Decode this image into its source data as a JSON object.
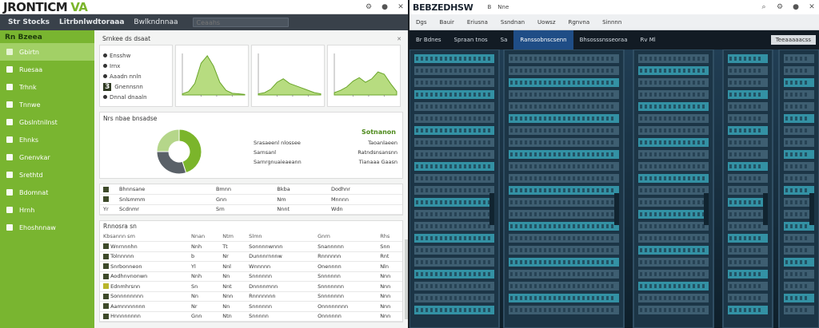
{
  "left_app": {
    "brand": "JRONTICM",
    "brand_suffix": "VA",
    "menu": [
      "Str Stocks",
      "Litrbnlwdtoraaa",
      "Bwlkndnnaa"
    ],
    "search_placeholder": "Ceaahs",
    "sidebar": {
      "header": "Rn Bzeea",
      "items": [
        "Gbirtn",
        "Ruesaa",
        "Trhnk",
        "Tnnwe",
        "Gbslntnilnst",
        "Ehnks",
        "Gnenvkar",
        "Srethtd",
        "Bdomnat",
        "Hrnh",
        "Ehoshnnaw"
      ]
    },
    "section_top": "Srnkee ds dsaat",
    "info_card": {
      "rows": [
        {
          "num": "",
          "label": "Ensshw"
        },
        {
          "num": "",
          "label": "Irnx"
        },
        {
          "num": "",
          "label": "Aaadn nnln"
        },
        {
          "num": "3",
          "label": "Gnennsnn"
        },
        {
          "num": "",
          "label": "Dnnal dnaaln"
        }
      ]
    },
    "panel_mid": {
      "title": "Nrs nbae bnsadse",
      "legend_head": "Sotnanon",
      "legend_rows": [
        [
          "Srasaeenl nlossee",
          "Taoanlaeen"
        ],
        [
          "Sarnsanl",
          "Ratndsnsansnn"
        ],
        [
          "Sarnrgnuaieaeann",
          "Tianaaa Gaasn"
        ]
      ]
    },
    "table1": {
      "cols": [
        "",
        "",
        "",
        "",
        ""
      ],
      "rows": [
        [
          "",
          "Bhnnsane",
          "Bmnn",
          "Bkba",
          "Dodhnr"
        ],
        [
          "",
          "Snlsmmm",
          "Gnn",
          "Nm",
          "Mnnnn"
        ],
        [
          "Yr",
          "Scdnmr",
          "Srn",
          "Nnnt",
          "Wdn"
        ]
      ]
    },
    "table2": {
      "title": "Rnnosra sn",
      "head": [
        "Kbsannn sm",
        "Nnan",
        "Ntm",
        "Slmn",
        "Gnrn",
        "Rhs"
      ],
      "rows": [
        [
          "Wnrnnnhn",
          "Nnh",
          "Tt",
          "Sonnnnwnnn",
          "Snannnnn",
          "Snn"
        ],
        [
          "Tolnnnnn",
          "b",
          "Nr",
          "Dunnnrnnnw",
          "Rnnnnnn",
          "Rnt"
        ],
        [
          "Snrbonneon",
          "Yl",
          "Nnl",
          "Wnnnnn",
          "Onennnn",
          "Nln"
        ],
        [
          "Aodhnvnonwn",
          "Nnh",
          "Nn",
          "Snnnnnn",
          "Snnnnnn",
          "Nnn"
        ],
        [
          "Ednmhrsnn",
          "Sn",
          "Nnt",
          "Dnnnnmnn",
          "Snnnnnnn",
          "Nnn"
        ],
        [
          "Sonnnnnnnn",
          "Nn",
          "Nnn",
          "Rnnnnnnn",
          "Snnnnnnn",
          "Nnn"
        ],
        [
          "Aamnnnnnnn",
          "Nr",
          "Nn",
          "Snnnnnn",
          "Onnnnnnnn",
          "Nnn"
        ],
        [
          "Hnnnnnnnn",
          "Gnn",
          "Ntn",
          "Snnnnn",
          "Onnnnnn",
          "Nnn"
        ]
      ]
    }
  },
  "right_app": {
    "brand": "BEBZEDHSW",
    "title_menu": [
      "B",
      "Nne"
    ],
    "tabs": [
      "Dgs",
      "Bauir",
      "Eriusna",
      "Ssndnan",
      "Uowsz",
      "Rgnvna",
      "Sinnnn"
    ],
    "nav": [
      "Br Bdnes",
      "Spraan tnos",
      "Sa",
      "Ranssobnscsenn",
      "Bhsosssnsseoraa",
      "Rv Ml"
    ],
    "nav_right": "Teeaaaaacss"
  },
  "colors": {
    "accent_green": "#79b530",
    "dark_bar": "#39414a",
    "nav_blue": "#1f4d86"
  },
  "chart_data": [
    {
      "type": "area",
      "x": [
        0,
        1,
        2,
        3,
        4,
        5,
        6,
        7,
        8,
        9,
        10
      ],
      "values": [
        2,
        6,
        20,
        55,
        68,
        50,
        22,
        8,
        3,
        2,
        1
      ]
    },
    {
      "type": "area",
      "x": [
        0,
        1,
        2,
        3,
        4,
        5,
        6,
        7,
        8,
        9,
        10
      ],
      "values": [
        2,
        4,
        10,
        22,
        28,
        20,
        16,
        12,
        8,
        4,
        2
      ]
    },
    {
      "type": "area",
      "x": [
        0,
        1,
        2,
        3,
        4,
        5,
        6,
        7,
        8,
        9,
        10
      ],
      "values": [
        4,
        8,
        14,
        24,
        30,
        22,
        28,
        40,
        36,
        20,
        6
      ]
    },
    {
      "type": "pie",
      "values": [
        45,
        30,
        25
      ],
      "colors": [
        "#7bb52b",
        "#5a6168",
        "#b5d68a"
      ]
    }
  ]
}
